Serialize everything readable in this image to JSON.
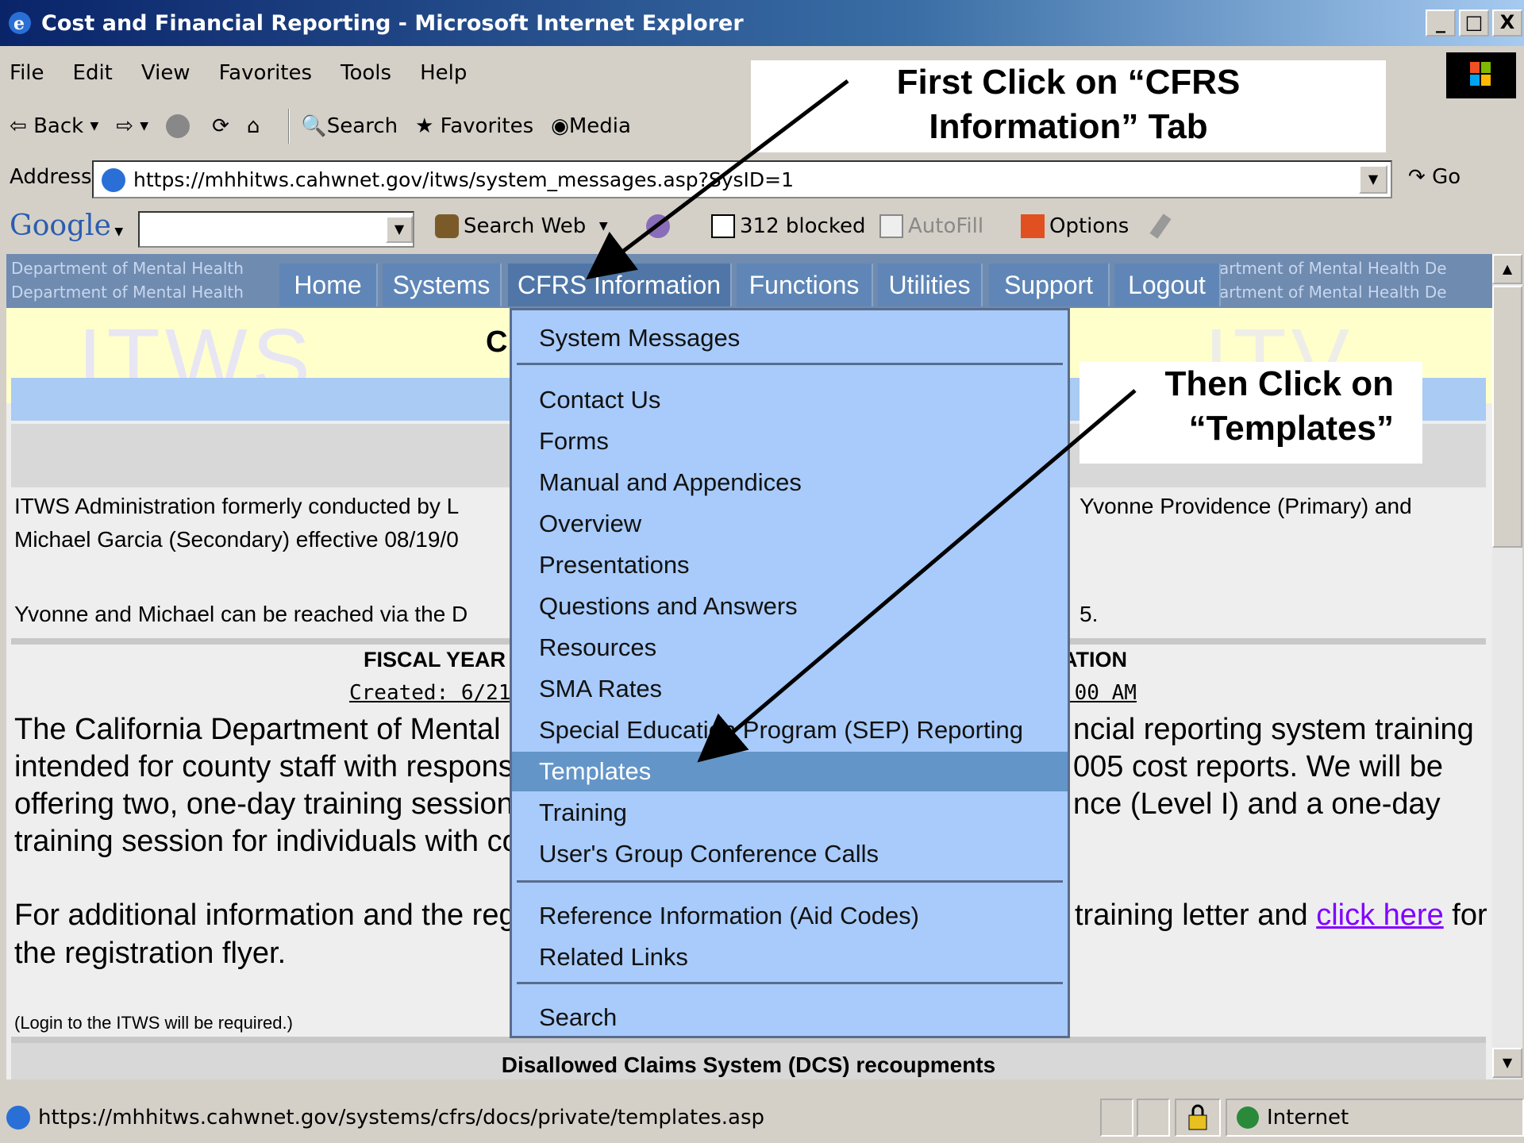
{
  "window": {
    "title": "Cost and Financial Reporting - Microsoft Internet Explorer",
    "min": "_",
    "max": "□",
    "close": "X"
  },
  "menu": [
    "File",
    "Edit",
    "View",
    "Favorites",
    "Tools",
    "Help"
  ],
  "toolbar": {
    "back": "Back",
    "search": "Search",
    "favorites": "Favorites",
    "media": "Media"
  },
  "address": {
    "label": "Address",
    "url": "https://mhhitws.cahwnet.gov/itws/system_messages.asp?SysID=1",
    "go": "Go"
  },
  "google": {
    "logo": "Google",
    "search_web": "Search Web",
    "blocked": "312 blocked",
    "autofill": "AutoFill",
    "options": "Options"
  },
  "site": {
    "bg_text": "Department of Mental Health",
    "bg_text_right": "artment of Mental Health  De",
    "watermark": "ITWS",
    "nav": [
      "Home",
      "Systems",
      "CFRS Information",
      "Functions",
      "Utilities",
      "Support",
      "Logout"
    ],
    "heading_fragment": "C",
    "admin_text_left_1": "ITWS Administration formerly conducted by L",
    "admin_text_right_1": "Yvonne Providence (Primary) and",
    "admin_text_left_2": "Michael Garcia (Secondary) effective 08/19/0",
    "reach_left": "Yvonne and Michael can be reached via the D",
    "reach_right": "5.",
    "fy_left": "FISCAL YEAR",
    "fy_right": "ATION",
    "created_left": "Created: 6/21/",
    "created_right": ":00 AM",
    "body_left": [
      "The California Department of Mental H",
      "intended for county staff with responsi",
      "offering two, one-day training session",
      "training session for individuals with co"
    ],
    "body_right": [
      "ncial reporting system training",
      "005 cost reports.  We will be",
      "nce (Level I) and a one-day",
      ""
    ],
    "additional_left": "For additional information and the reg",
    "additional_right": "training letter and",
    "link": "click here",
    "for": "for",
    "flyer": "the registration flyer.",
    "login_note": "(Login to the ITWS will be required.)",
    "dcs": "Disallowed Claims System (DCS) recoupments"
  },
  "dropdown": {
    "group1": [
      "System Messages"
    ],
    "group2": [
      "Contact Us",
      "Forms",
      "Manual and Appendices",
      "Overview",
      "Presentations",
      "Questions and Answers",
      "Resources",
      "SMA Rates",
      "Special Education Program (SEP) Reporting",
      "Templates",
      "Training",
      "User's Group Conference Calls"
    ],
    "group3": [
      "Reference Information (Aid Codes)",
      "Related Links"
    ],
    "group4": [
      "Search"
    ],
    "selected": "Templates"
  },
  "annotations": {
    "first": [
      "First Click on “CFRS",
      "Information” Tab"
    ],
    "then": [
      "Then Click  on",
      "“Templates”"
    ]
  },
  "status": {
    "url": "https://mhhitws.cahwnet.gov/systems/cfrs/docs/private/templates.asp",
    "zone": "Internet"
  },
  "colors": {
    "title_start": "#0a246a",
    "nav_tab": "#5f86b7",
    "dropdown": "#a8cbfb",
    "selected": "#6395c8",
    "link": "#8000ff"
  }
}
